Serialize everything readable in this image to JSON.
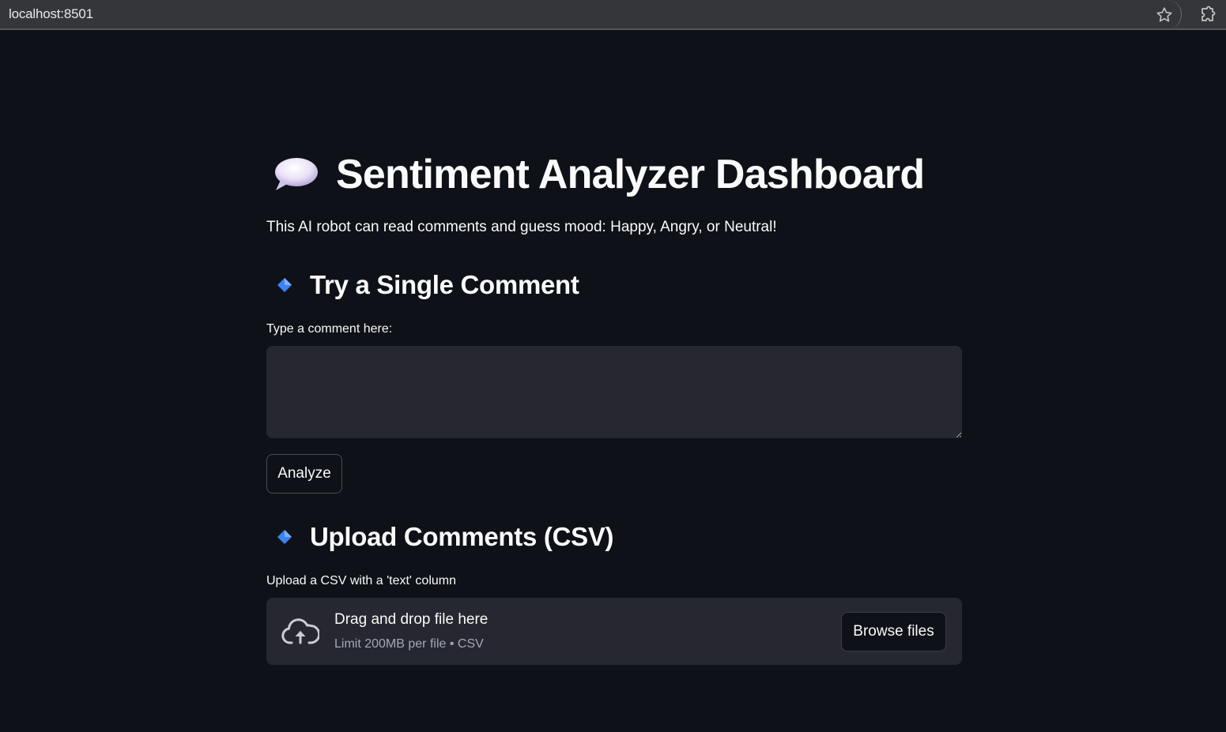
{
  "browser": {
    "url": "localhost:8501",
    "icons": [
      "star-icon",
      "extensions-icon"
    ]
  },
  "header": {
    "icon": "speech-balloon-icon",
    "title": "Sentiment Analyzer Dashboard",
    "subtitle": "This AI robot can read comments and guess mood: Happy, Angry, or Neutral!"
  },
  "single_comment": {
    "icon": "diamond-icon",
    "heading": "Try a Single Comment",
    "input_label": "Type a comment here:",
    "input_value": "",
    "button_label": "Analyze"
  },
  "upload": {
    "icon": "diamond-icon",
    "heading": "Upload Comments (CSV)",
    "label": "Upload a CSV with a 'text' column",
    "dropzone_icon": "cloud-upload-icon",
    "dropzone_title": "Drag and drop file here",
    "dropzone_hint": "Limit 200MB per file • CSV",
    "button_label": "Browse files"
  },
  "colors": {
    "background": "#0e1117",
    "surface": "#262730",
    "text": "#fafafa",
    "muted_text": "#a3a8b4",
    "accent_diamond": "#3b82f6"
  }
}
